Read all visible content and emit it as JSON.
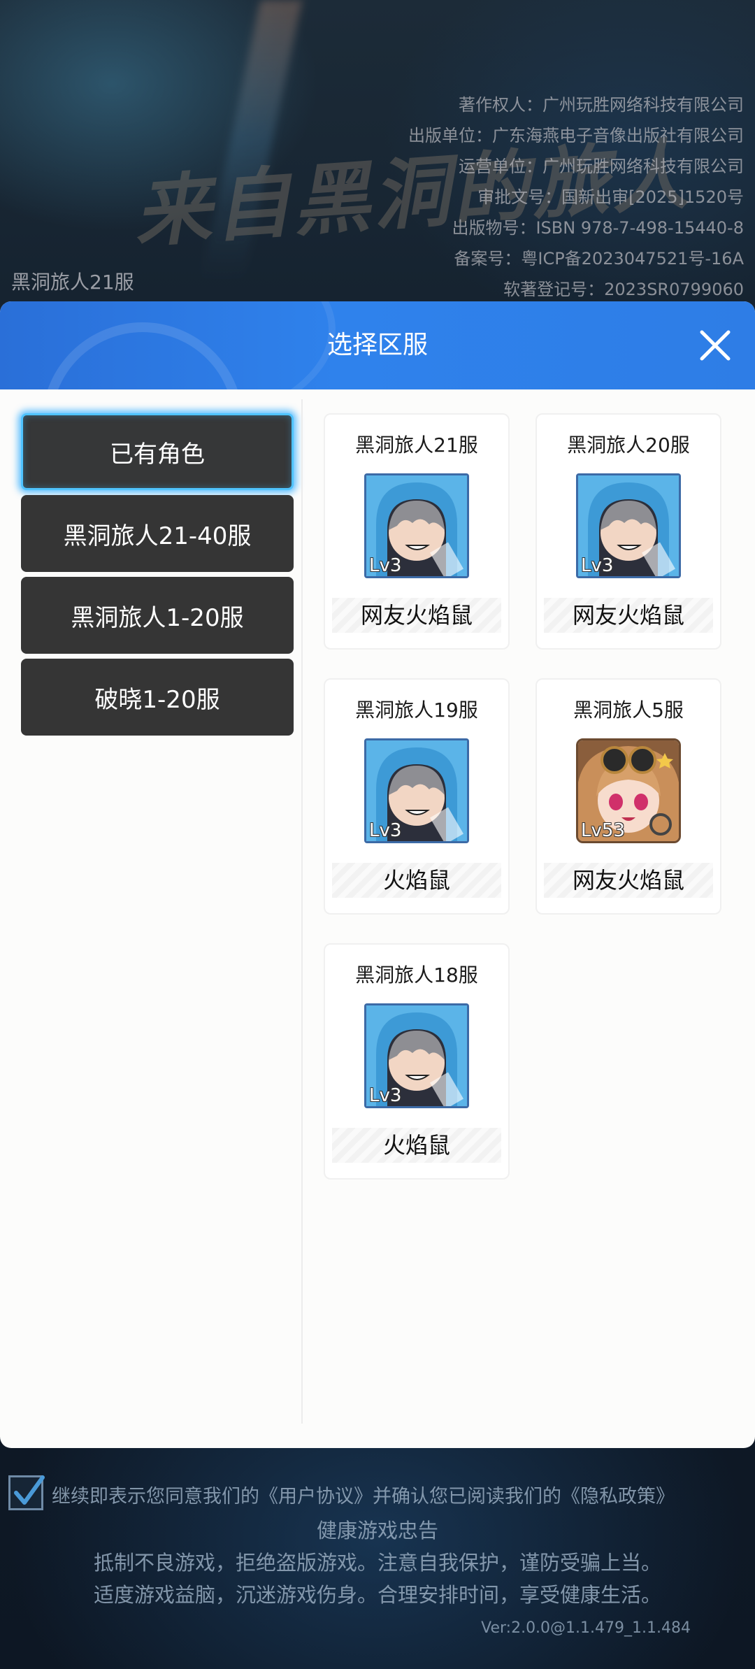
{
  "background": {
    "credits": [
      "著作权人：广州玩胜网络科技有限公司",
      "出版单位：广东海燕电子音像出版社有限公司",
      "运营单位：广州玩胜网络科技有限公司",
      "审批文号：国新出审[2025]1520号",
      "出版物号：ISBN 978-7-498-15440-8",
      "备案号：粤ICP备2023047521号-16A",
      "软著登记号：2023SR0799060"
    ],
    "logo_text": "来自黑洞的旅人",
    "current_server": "黑洞旅人21服"
  },
  "modal": {
    "title": "选择区服",
    "tabs": [
      {
        "label": "已有角色",
        "active": true
      },
      {
        "label": "黑洞旅人21-40服",
        "active": false
      },
      {
        "label": "黑洞旅人1-20服",
        "active": false
      },
      {
        "label": "破晓1-20服",
        "active": false
      }
    ],
    "roles": [
      {
        "server": "黑洞旅人21服",
        "level": "Lv3",
        "name": "网友火焰鼠",
        "avatar": "hooded-boy-avatar"
      },
      {
        "server": "黑洞旅人20服",
        "level": "Lv3",
        "name": "网友火焰鼠",
        "avatar": "hooded-boy-avatar"
      },
      {
        "server": "黑洞旅人19服",
        "level": "Lv3",
        "name": "火焰鼠",
        "avatar": "hooded-boy-avatar"
      },
      {
        "server": "黑洞旅人5服",
        "level": "Lv53",
        "name": "网友火焰鼠",
        "avatar": "goggles-girl-avatar"
      },
      {
        "server": "黑洞旅人18服",
        "level": "Lv3",
        "name": "火焰鼠",
        "avatar": "hooded-boy-avatar"
      }
    ]
  },
  "footer": {
    "agree_prefix": "继续即表示您同意我们的",
    "user_agreement": "《用户协议》",
    "agree_middle": "并确认您已阅读我们的",
    "privacy_policy": "《隐私政策》",
    "health_title": "健康游戏忠告",
    "health_line1": "抵制不良游戏，拒绝盗版游戏。注意自我保护，谨防受骗上当。",
    "health_line2": "适度游戏益脑，沉迷游戏伤身。合理安排时间，享受健康生活。",
    "version": "Ver:2.0.0@1.1.479_1.1.484",
    "agreed": true
  },
  "colors": {
    "header_blue": "#2f82ec",
    "active_glow": "#4fc3ff",
    "tab_bg": "#353535"
  }
}
